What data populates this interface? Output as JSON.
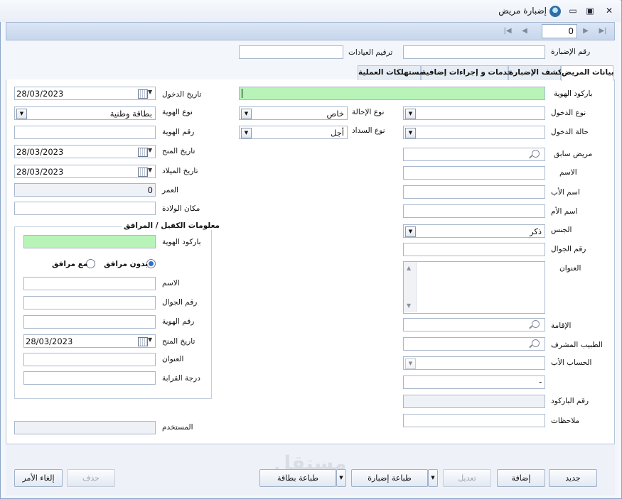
{
  "window": {
    "title": "إضبارة مريض"
  },
  "navigator": {
    "page_value": "0"
  },
  "header_fields": {
    "record_number_label": "رقم الإضبارة",
    "clinic_number_label": "ترقيم العيادات"
  },
  "tabs": [
    {
      "label": "بيانات المريض"
    },
    {
      "label": "كشف الإضبارة"
    },
    {
      "label": "خدمات و إجراءات إضافية"
    },
    {
      "label": "مستهلكات العملية"
    }
  ],
  "right": {
    "barcode_label": "باركود الهوية",
    "entry_type_label": "نوع الدخول",
    "entry_status_label": "حالة الدخول",
    "previous_patient_label": "مريض سابق",
    "name_label": "الاسم",
    "father_name_label": "اسم الأب",
    "mother_name_label": "اسم الأم",
    "gender_label": "الجنس",
    "gender_value": "ذكر",
    "mobile_label": "رقم الجوال",
    "address_label": "العنوان",
    "residence_label": "الإقامة",
    "doctor_label": "الطبيب المشرف",
    "father_account_label": "الحساب الأب",
    "dash_value": "-",
    "barcode_number_label": "رقم الباركود",
    "notes_label": "ملاحظات"
  },
  "middle": {
    "referral_type_label": "نوع الإحالة",
    "referral_type_value": "خاص",
    "payment_type_label": "نوع السداد",
    "payment_type_value": "أجل"
  },
  "left": {
    "entry_date_label": "تاريخ الدخول",
    "entry_date_value": "28/03/2023",
    "id_type_label": "نوع الهوية",
    "id_type_value": "بطاقة وطنية",
    "id_number_label": "رقم الهوية",
    "issue_date_label": "تاريخ المنح",
    "issue_date_value": "28/03/2023",
    "birth_date_label": "تاريخ الميلاد",
    "birth_date_value": "28/03/2023",
    "age_label": "العمر",
    "age_value": "0",
    "birthplace_label": "مكان الولادة",
    "user_label": "المستخدم"
  },
  "guarantor": {
    "title": "معلومات الكفيل / المرافق",
    "barcode_label": "باركود الهوية",
    "without_companion": "بدون مرافق",
    "with_companion": "مع مرافق",
    "name_label": "الاسم",
    "mobile_label": "رقم الجوال",
    "id_number_label": "رقم الهوية",
    "issue_date_label": "تاريخ المنح",
    "issue_date_value": "28/03/2023",
    "address_label": "العنوان",
    "relation_label": "درجة القرابة"
  },
  "footer": {
    "new": "جديد",
    "add": "إضافة",
    "edit": "تعديل",
    "print_record": "طباعة إضبارة",
    "print_card": "طباعة بطاقة",
    "delete": "حذف",
    "cancel": "إلغاء الأمر"
  },
  "watermark": "مستقل"
}
